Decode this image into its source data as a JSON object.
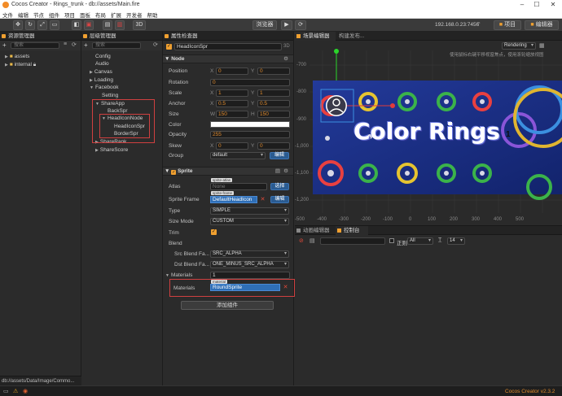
{
  "window": {
    "title": "Cocos Creator - Rings_trunk - db://assets/Main.fire"
  },
  "menu": [
    "文件",
    "编辑",
    "节点",
    "组件",
    "项目",
    "面板",
    "布局",
    "扩展",
    "开发者",
    "帮助"
  ],
  "toolbar": {
    "mode_3d": "3D",
    "platform": "浏览器",
    "ip": "192.168.0.23:7456",
    "project_btn": "项目",
    "editor_btn": "编辑器"
  },
  "assets": {
    "title": "资源管理器",
    "search_placeholder": "搜索",
    "items": [
      "assets",
      "internal"
    ],
    "path": "db://assets/Data/Image/Commo..."
  },
  "hierarchy": {
    "title": "层级管理器",
    "search_placeholder": "搜索",
    "items": [
      "Config",
      "Audio",
      "Canvas",
      "Loading",
      "Facebook",
      "Setting",
      "ShareApp",
      "BackSpr",
      "HeadIconNode",
      "HeadIconSpr",
      "BorderSpr",
      "ShareRank",
      "ShareScore"
    ]
  },
  "inspector": {
    "title": "属性检查器",
    "node_name": "HeadIconSpr",
    "badge_3d": "3D",
    "node_section": "Node",
    "position": {
      "label": "Position",
      "x": "0",
      "y": "0"
    },
    "rotation": {
      "label": "Rotation",
      "value": "0"
    },
    "scale": {
      "label": "Scale",
      "x": "1",
      "y": "1"
    },
    "anchor": {
      "label": "Anchor",
      "x": "0.5",
      "y": "0.5"
    },
    "size": {
      "label": "Size",
      "w": "150",
      "h": "150"
    },
    "color": {
      "label": "Color"
    },
    "opacity": {
      "label": "Opacity",
      "value": "255"
    },
    "skew": {
      "label": "Skew",
      "x": "0",
      "y": "0"
    },
    "group": {
      "label": "Group",
      "value": "default",
      "edit": "编辑"
    },
    "axis_x": "X",
    "axis_y": "Y",
    "axis_w": "W",
    "axis_h": "H",
    "sprite_section": "Sprite",
    "atlas": {
      "label": "Atlas",
      "tag": "sprite-atlas",
      "value": "None",
      "btn": "选择"
    },
    "sprite_frame": {
      "label": "Sprite Frame",
      "tag": "sprite-frame",
      "value": "DefaultHeadIcon",
      "btn": "编辑"
    },
    "type": {
      "label": "Type",
      "value": "SIMPLE"
    },
    "size_mode": {
      "label": "Size Mode",
      "value": "CUSTOM"
    },
    "trim": {
      "label": "Trim"
    },
    "blend": {
      "label": "Blend"
    },
    "src_blend": {
      "label": "Src Blend Fa...",
      "value": "SRC_ALPHA"
    },
    "dst_blend": {
      "label": "Dst Blend Fa...",
      "value": "ONE_MINUS_SRC_ALPHA"
    },
    "materials_group": {
      "label": "Materials",
      "count": "1"
    },
    "materials": {
      "label": "Materials",
      "tag": "material",
      "value": "RoundSprite"
    },
    "add_component": "添加组件"
  },
  "scene": {
    "title": "场景编辑器",
    "tab2": "构建发布...",
    "rendering": "Rendering",
    "hint": "使用鼠标右键平移视窗焦点，使用滚轮缩放视图",
    "y_axis": [
      "-700",
      "-800",
      "-900",
      "-1,000",
      "-1,100",
      "-1,200"
    ],
    "x_axis": [
      "-500",
      "-400",
      "-300",
      "-200",
      "-100",
      "0",
      "100",
      "200",
      "300",
      "400",
      "500"
    ],
    "banner_text": "Color Rings",
    "number": "1"
  },
  "console": {
    "tab1": "动画编辑器",
    "tab2": "控制台",
    "regex": "正则",
    "level": "All",
    "font_size": "14"
  },
  "status": {
    "version": "Cocos Creator v2.3.2"
  },
  "colors": {
    "accent": "#f0a030",
    "selection": "#2f6fb7",
    "highlight_box": "#d04040"
  }
}
